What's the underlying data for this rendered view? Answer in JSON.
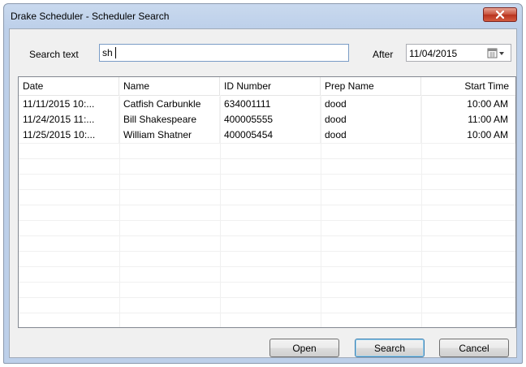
{
  "window": {
    "title": "Drake Scheduler - Scheduler Search"
  },
  "search": {
    "label": "Search text",
    "value": "sh"
  },
  "after": {
    "label": "After",
    "date": "11/04/2015"
  },
  "table": {
    "columns": [
      "Date",
      "Name",
      "ID Number",
      "Prep Name",
      "Start Time"
    ],
    "rows": [
      [
        "11/11/2015 10:...",
        "Catfish Carbunkle",
        "634001111",
        "dood",
        "10:00 AM"
      ],
      [
        "11/24/2015 11:...",
        "Bill Shakespeare",
        "400005555",
        "dood",
        "11:00 AM"
      ],
      [
        "11/25/2015 10:...",
        "William Shatner",
        "400005454",
        "dood",
        "10:00 AM"
      ]
    ]
  },
  "buttons": {
    "open": "Open",
    "search": "Search",
    "cancel": "Cancel"
  },
  "colors": {
    "title_bar": "#bdd0ea",
    "close_button": "#c8503a",
    "client": "#f0f0f0",
    "default_button_border": "#3c7fb1"
  },
  "icons": {
    "close": "close-icon",
    "calendar": "calendar-dropdown-icon"
  }
}
